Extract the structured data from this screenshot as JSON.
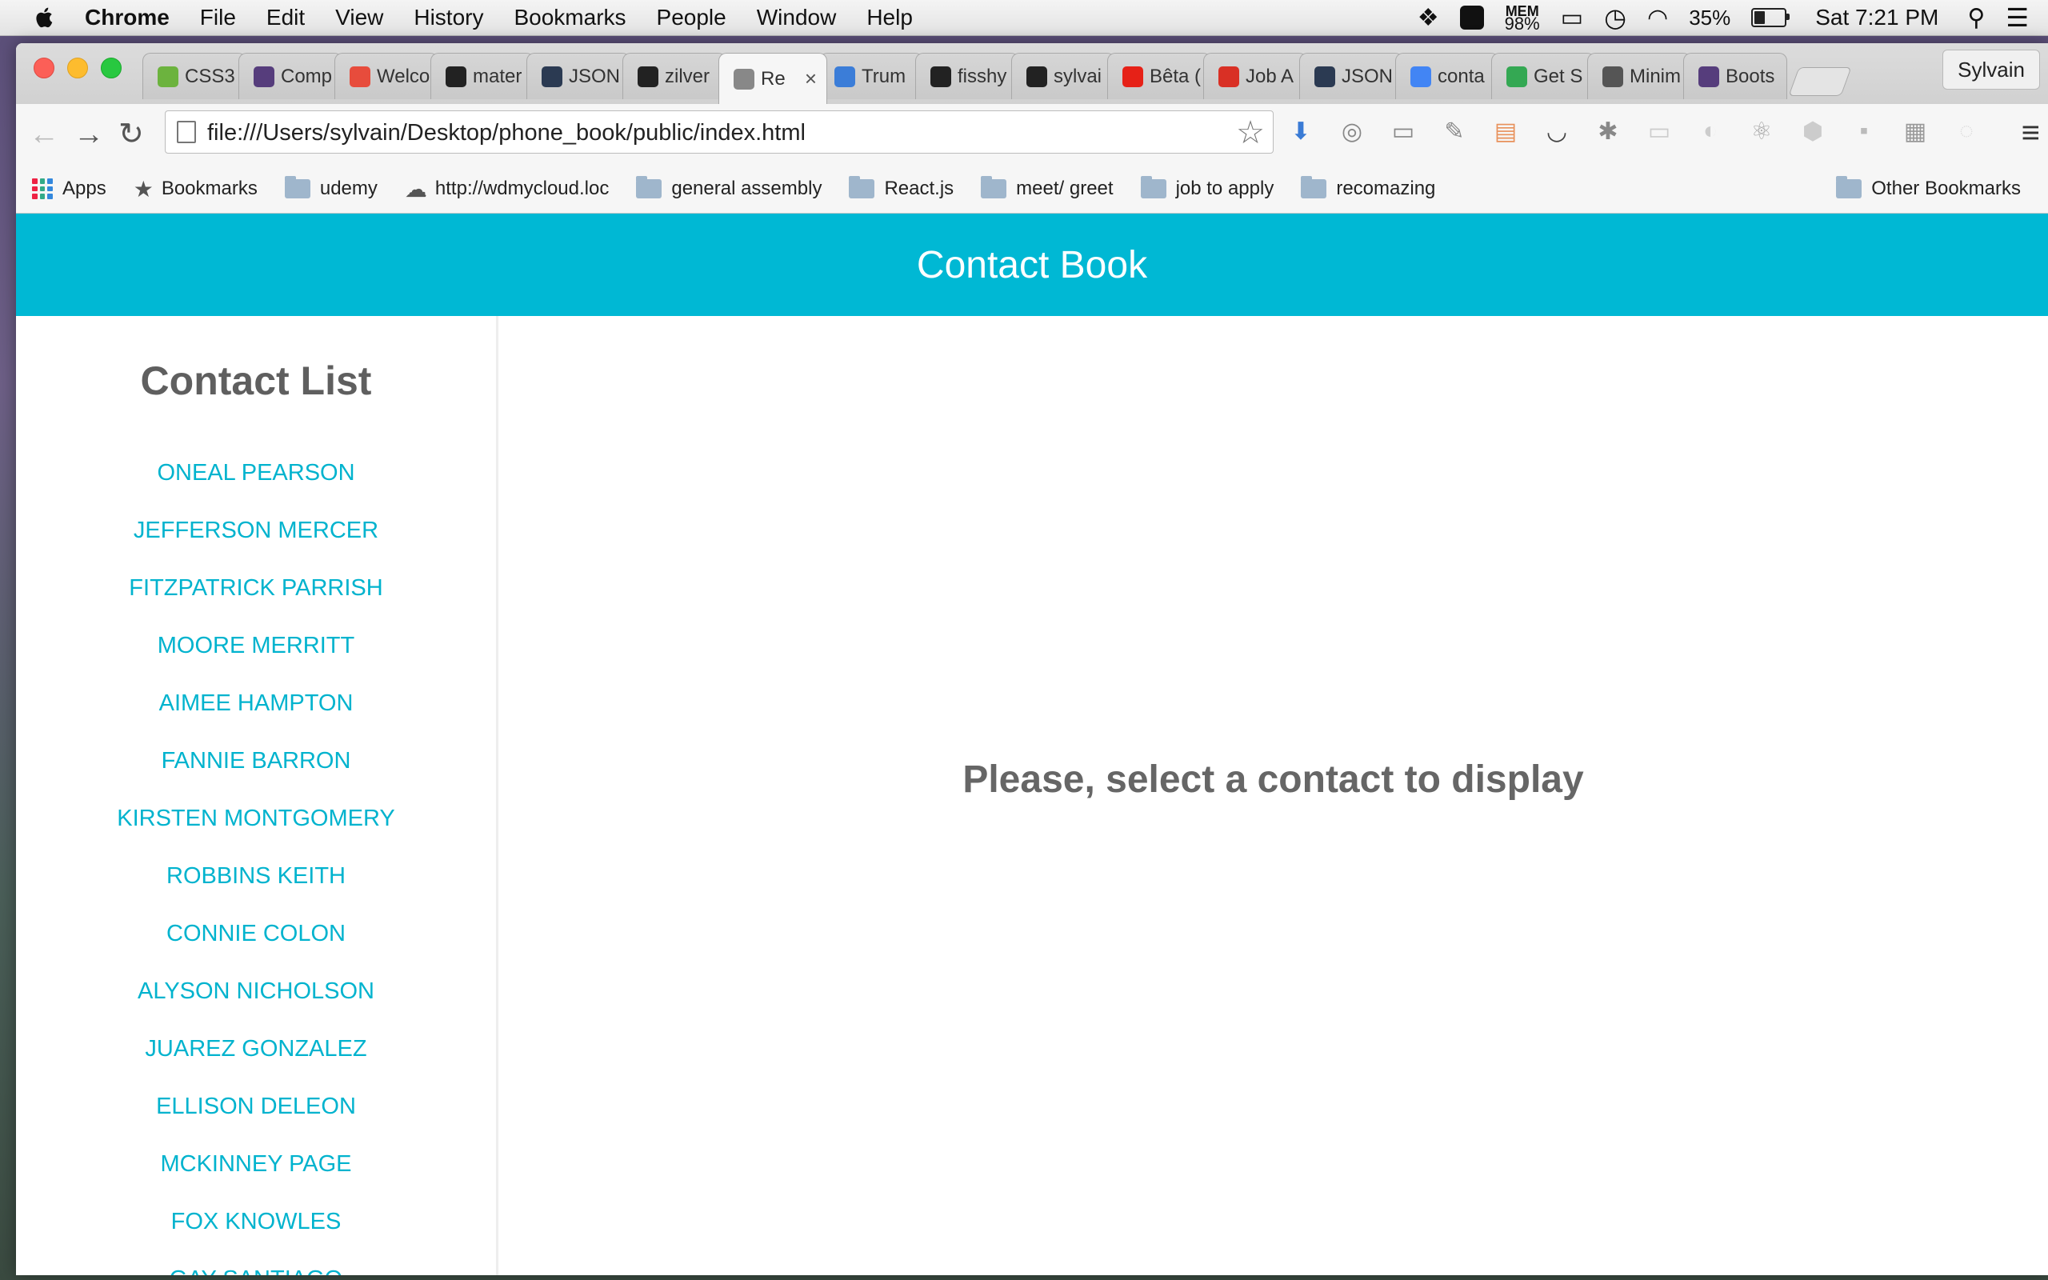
{
  "menubar": {
    "app_name": "Chrome",
    "menus": [
      "File",
      "Edit",
      "View",
      "History",
      "Bookmarks",
      "People",
      "Window",
      "Help"
    ],
    "mem_label": "MEM",
    "mem_value": "98%",
    "battery_percent": "35%",
    "battery_level": 0.35,
    "clock": "Sat 7:21 PM"
  },
  "browser": {
    "tabs": [
      {
        "label": "CSS3",
        "icon": "css3-icon",
        "color": "#6cb33e"
      },
      {
        "label": "Comp",
        "icon": "bootstrap-icon",
        "color": "#563d7c"
      },
      {
        "label": "Welco",
        "icon": "rm-icon",
        "color": "#e74c3c"
      },
      {
        "label": "mater",
        "icon": "github-icon",
        "color": "#222"
      },
      {
        "label": "JSON",
        "icon": "json-icon",
        "color": "#2b3a52"
      },
      {
        "label": "zilver",
        "icon": "github-icon",
        "color": "#222"
      },
      {
        "label": "Re",
        "icon": "page-icon",
        "color": "#888",
        "active": true
      },
      {
        "label": "Trum",
        "icon": "trumpet-icon",
        "color": "#3b7dd8"
      },
      {
        "label": "fisshy",
        "icon": "github-icon",
        "color": "#222"
      },
      {
        "label": "sylvai",
        "icon": "github-icon",
        "color": "#222"
      },
      {
        "label": "Bêta (",
        "icon": "youtube-icon",
        "color": "#e62117"
      },
      {
        "label": "Job A",
        "icon": "gmail-icon",
        "color": "#d93025"
      },
      {
        "label": "JSON",
        "icon": "json-icon",
        "color": "#2b3a52"
      },
      {
        "label": "conta",
        "icon": "google-icon",
        "color": "#4285f4"
      },
      {
        "label": "Get S",
        "icon": "chrome-store-icon",
        "color": "#34a853"
      },
      {
        "label": "Minim",
        "icon": "arch-icon",
        "color": "#555"
      },
      {
        "label": "Boots",
        "icon": "bootstrap-icon",
        "color": "#563d7c"
      }
    ],
    "profile_name": "Sylvain",
    "url": "file:///Users/sylvain/Desktop/phone_book/public/index.html",
    "bookmarks": [
      {
        "label": "Apps",
        "type": "apps"
      },
      {
        "label": "Bookmarks",
        "type": "star"
      },
      {
        "label": "udemy",
        "type": "folder"
      },
      {
        "label": "http://wdmycloud.loc",
        "type": "cloud"
      },
      {
        "label": "general assembly",
        "type": "folder"
      },
      {
        "label": "React.js",
        "type": "folder"
      },
      {
        "label": "meet/ greet",
        "type": "folder"
      },
      {
        "label": "job to apply",
        "type": "folder"
      },
      {
        "label": "recomazing",
        "type": "folder"
      }
    ],
    "other_bookmarks": "Other Bookmarks"
  },
  "app": {
    "header_title": "Contact Book",
    "accent_color": "#00b8d4",
    "sidebar_title": "Contact List",
    "contacts": [
      "ONEAL PEARSON",
      "JEFFERSON MERCER",
      "FITZPATRICK PARRISH",
      "MOORE MERRITT",
      "AIMEE HAMPTON",
      "FANNIE BARRON",
      "KIRSTEN MONTGOMERY",
      "ROBBINS KEITH",
      "CONNIE COLON",
      "ALYSON NICHOLSON",
      "JUAREZ GONZALEZ",
      "ELLISON DELEON",
      "MCKINNEY PAGE",
      "FOX KNOWLES",
      "GAY SANTIAGO"
    ],
    "empty_message": "Please, select a contact to display"
  }
}
